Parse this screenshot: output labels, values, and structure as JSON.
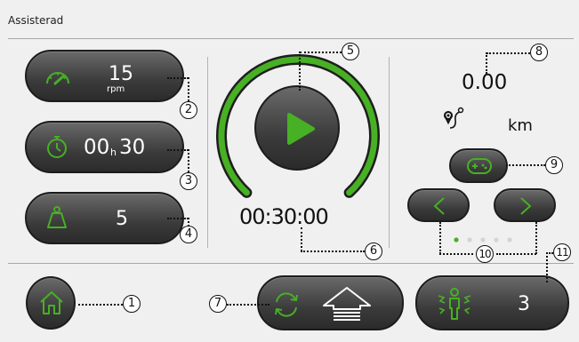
{
  "header": {
    "title": "Assisterad"
  },
  "speed": {
    "value": "15",
    "unit": "rpm",
    "icon": "speedometer-icon"
  },
  "timer": {
    "hours": "00",
    "h_sep": "h",
    "minutes": "30",
    "icon": "stopwatch-icon"
  },
  "resistance": {
    "value": "5",
    "icon": "weight-icon"
  },
  "playback": {
    "icon": "play-icon",
    "progress_fraction": 0.8,
    "time": "00:30:00"
  },
  "distance": {
    "value": "0.00",
    "unit": "km",
    "icon": "route-icon"
  },
  "game": {
    "icon": "gamepad-icon"
  },
  "pager": {
    "prev_icon": "chevron-left-icon",
    "next_icon": "chevron-right-icon",
    "page_count": 5,
    "active_page": 1
  },
  "bottom": {
    "home_icon": "home-icon",
    "direction_icons": [
      "rotate-icon",
      "arrow-up-icon"
    ],
    "spasm": {
      "value": "3",
      "icon": "spasm-person-icon"
    }
  },
  "callouts": [
    "1",
    "2",
    "3",
    "4",
    "5",
    "6",
    "7",
    "8",
    "9",
    "10",
    "11"
  ],
  "colors": {
    "accent": "#47b024",
    "button_dark": "#3a3a3a",
    "background": "#f0f0f0"
  }
}
